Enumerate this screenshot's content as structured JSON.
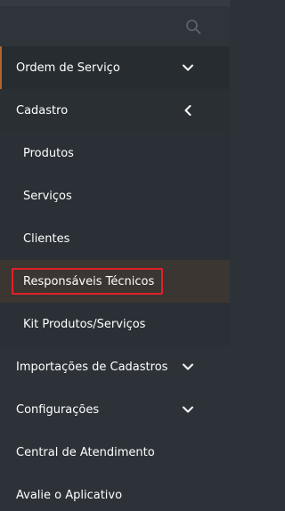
{
  "search": {
    "icon": "search-icon"
  },
  "menu": {
    "ordem": {
      "label": "Ordem de Serviço",
      "icon": "chevron-down-icon"
    },
    "cadastro": {
      "label": "Cadastro",
      "icon": "chevron-left-icon",
      "children": [
        {
          "label": "Produtos"
        },
        {
          "label": "Serviços"
        },
        {
          "label": "Clientes"
        },
        {
          "label": "Responsáveis Técnicos"
        },
        {
          "label": "Kit Produtos/Serviços"
        }
      ]
    },
    "importacoes": {
      "label": "Importações de Cadastros",
      "icon": "chevron-down-icon"
    },
    "configuracoes": {
      "label": "Configurações",
      "icon": "chevron-down-icon"
    },
    "central": {
      "label": "Central de Atendimento"
    },
    "avalie": {
      "label": "Avalie o Aplicativo"
    }
  },
  "colors": {
    "background": "#2c3238",
    "accent": "#b4652b",
    "highlight_border": "#e0212a",
    "highlight_background": "#3b3632"
  }
}
